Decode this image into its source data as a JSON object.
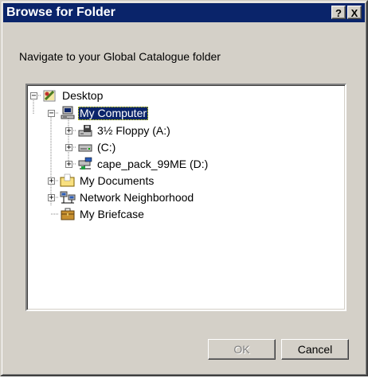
{
  "window": {
    "title": "Browse for Folder",
    "help_label": "?",
    "close_label": "X"
  },
  "instruction": "Navigate to your Global Catalogue folder",
  "tree": {
    "desktop": "Desktop",
    "my_computer": "My Computer",
    "floppy": "3½ Floppy (A:)",
    "c_drive": "(C:)",
    "d_drive": "cape_pack_99ME (D:)",
    "my_documents": "My Documents",
    "network": "Network Neighborhood",
    "briefcase": "My Briefcase",
    "selected": "My Computer"
  },
  "buttons": {
    "ok": "OK",
    "cancel": "Cancel",
    "ok_enabled": false
  },
  "colors": {
    "title_bar": "#0a246a",
    "face": "#d4d0c8",
    "selection": "#0a246a"
  }
}
